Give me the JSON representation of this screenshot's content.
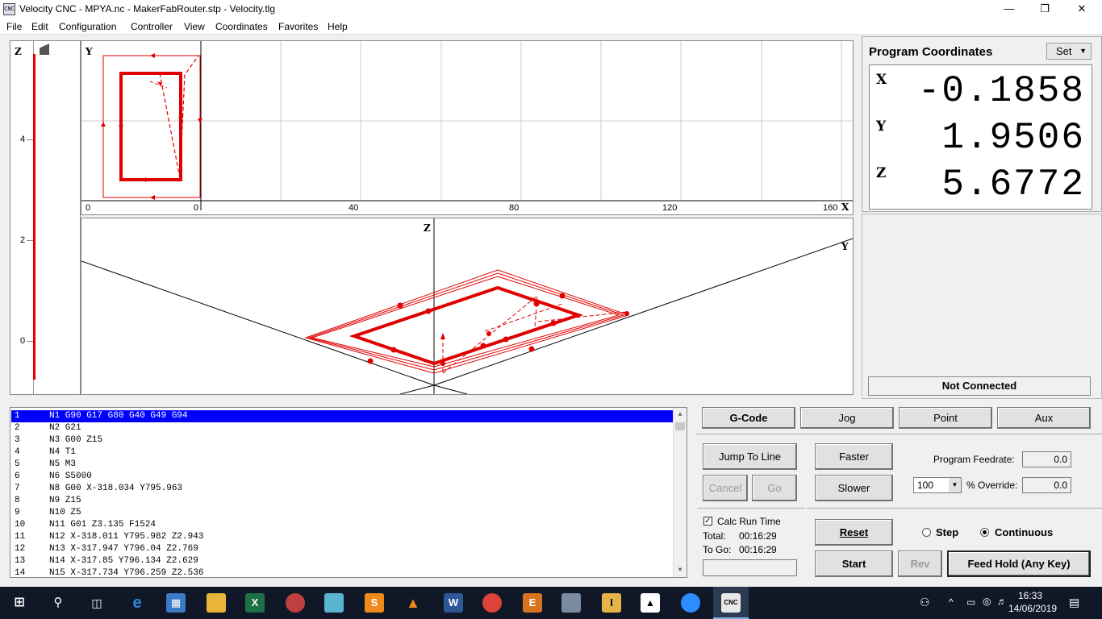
{
  "window": {
    "title": "Velocity CNC - MPYA.nc - MakerFabRouter.stp - Velocity.tlg",
    "icon": "cnc-app-icon",
    "controls": [
      "minimize-icon",
      "maximize-icon",
      "close-icon"
    ]
  },
  "menu": [
    "File",
    "Edit",
    "Configuration",
    "Controller",
    "View",
    "Coordinates",
    "Favorites",
    "Help"
  ],
  "z_gauge": {
    "axis_label": "Z",
    "ticks": [
      "4",
      "2",
      "0"
    ]
  },
  "xy_view": {
    "y_label": "Y",
    "x_label": "X",
    "ticks": [
      "0",
      "0",
      "40",
      "80",
      "120",
      "160"
    ]
  },
  "iso_view": {
    "z_label": "Z",
    "y_label": "Y"
  },
  "coords": {
    "header": "Program Coordinates",
    "set_label": "Set",
    "x_label": "X",
    "x_value": "-0.1858",
    "y_label": "Y",
    "y_value": "1.9506",
    "z_label": "Z",
    "z_value": "5.6772"
  },
  "status": "Not Connected",
  "gcode_lines": [
    {
      "n": "1",
      "code": "N1 G90 G17 G80 G40 G49 G94"
    },
    {
      "n": "2",
      "code": "N2 G21"
    },
    {
      "n": "3",
      "code": "N3 G00 Z15"
    },
    {
      "n": "4",
      "code": "N4 T1"
    },
    {
      "n": "5",
      "code": "N5 M3"
    },
    {
      "n": "6",
      "code": "N6 S5000"
    },
    {
      "n": "7",
      "code": "N8 G00 X-318.034 Y795.963"
    },
    {
      "n": "8",
      "code": "N9 Z15"
    },
    {
      "n": "9",
      "code": "N10 Z5"
    },
    {
      "n": "10",
      "code": "N11 G01 Z3.135 F1524"
    },
    {
      "n": "11",
      "code": "N12 X-318.011 Y795.982 Z2.943"
    },
    {
      "n": "12",
      "code": "N13 X-317.947 Y796.04 Z2.769"
    },
    {
      "n": "13",
      "code": "N14 X-317.85 Y796.134 Z2.629"
    },
    {
      "n": "14",
      "code": "N15 X-317.734 Y796.259 Z2.536"
    }
  ],
  "tabs": {
    "gcode": "G-Code",
    "jog": "Jog",
    "point": "Point",
    "aux": "Aux"
  },
  "controls": {
    "jump_to_line": "Jump To Line",
    "cancel": "Cancel",
    "go": "Go",
    "faster": "Faster",
    "slower": "Slower",
    "program_feedrate_label": "Program Feedrate:",
    "program_feedrate_value": "0.0",
    "override_select": "100",
    "override_label": "% Override:",
    "override_value": "0.0",
    "calc_run_time": "Calc Run Time",
    "total_label": "Total:",
    "total_value": "00:16:29",
    "to_go_label": "To Go:",
    "to_go_value": "00:16:29",
    "reset": "Reset",
    "step": "Step",
    "continuous": "Continuous",
    "start": "Start",
    "rev": "Rev",
    "feed_hold": "Feed Hold (Any Key)"
  },
  "taskbar": {
    "time": "16:33",
    "date": "14/06/2019"
  },
  "colors": {
    "toolpath": "#e00000",
    "selection": "#0000ff",
    "taskbar": "#101828"
  }
}
